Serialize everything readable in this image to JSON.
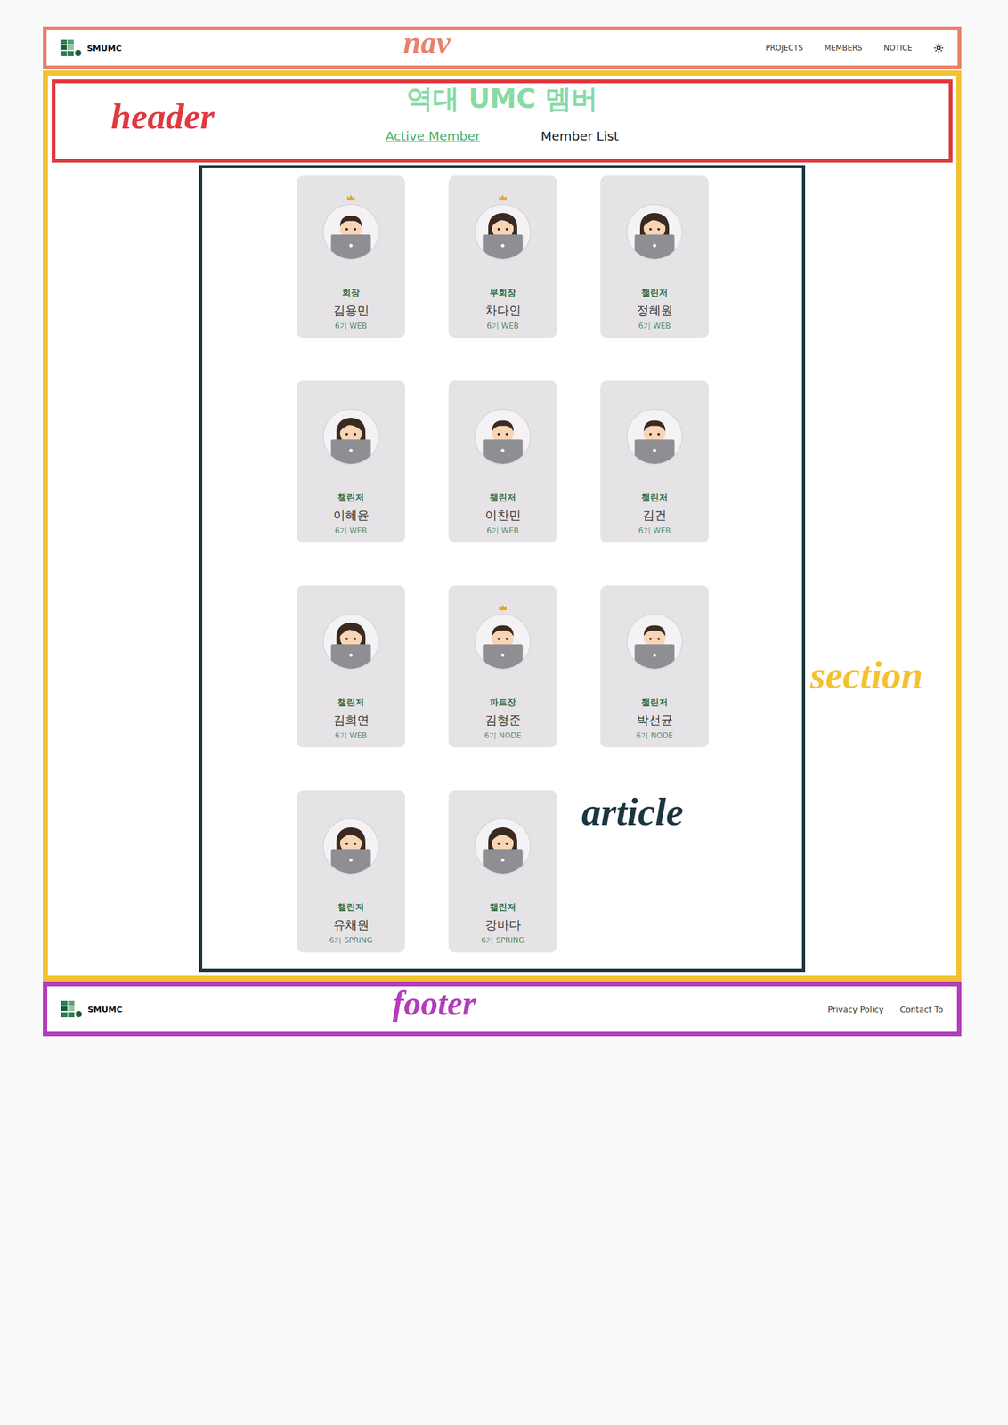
{
  "regions": {
    "nav": {
      "label": "nav",
      "color": "#e8826e"
    },
    "header": {
      "label": "header",
      "color": "#e0393e"
    },
    "section": {
      "label": "section",
      "color": "#f3c232"
    },
    "article": {
      "label": "article",
      "color": "#1b3640"
    },
    "footer": {
      "label": "footer",
      "color": "#b43cbc"
    }
  },
  "nav": {
    "brand": "SMUMC",
    "links": [
      "PROJECTS",
      "MEMBERS",
      "NOTICE"
    ]
  },
  "header": {
    "title": "역대 UMC 멤버",
    "tabs": [
      {
        "label": "Active Member",
        "selected": true
      },
      {
        "label": "Member List",
        "selected": false
      }
    ]
  },
  "members": [
    {
      "role": "회장",
      "name": "김용민",
      "gen": "6기 WEB",
      "crown": true,
      "kind": "man"
    },
    {
      "role": "부회장",
      "name": "차다인",
      "gen": "6기 WEB",
      "crown": true,
      "kind": "woman"
    },
    {
      "role": "챌린저",
      "name": "정혜원",
      "gen": "6기 WEB",
      "crown": false,
      "kind": "woman"
    },
    {
      "role": "챌린저",
      "name": "이혜윤",
      "gen": "6기 WEB",
      "crown": false,
      "kind": "woman"
    },
    {
      "role": "챌린저",
      "name": "이찬민",
      "gen": "6기 WEB",
      "crown": false,
      "kind": "man"
    },
    {
      "role": "챌린저",
      "name": "김건",
      "gen": "6기 WEB",
      "crown": false,
      "kind": "man"
    },
    {
      "role": "챌린저",
      "name": "김희연",
      "gen": "6기 WEB",
      "crown": false,
      "kind": "woman"
    },
    {
      "role": "파트장",
      "name": "김형준",
      "gen": "6기 NODE",
      "crown": true,
      "kind": "man"
    },
    {
      "role": "챌린저",
      "name": "박선균",
      "gen": "6기 NODE",
      "crown": false,
      "kind": "man"
    },
    {
      "role": "챌린저",
      "name": "유채원",
      "gen": "6기 SPRING",
      "crown": false,
      "kind": "woman"
    },
    {
      "role": "챌린저",
      "name": "강바다",
      "gen": "6기 SPRING",
      "crown": false,
      "kind": "woman"
    }
  ],
  "footer": {
    "brand": "SMUMC",
    "links": [
      "Privacy Policy",
      "Contact To"
    ]
  }
}
